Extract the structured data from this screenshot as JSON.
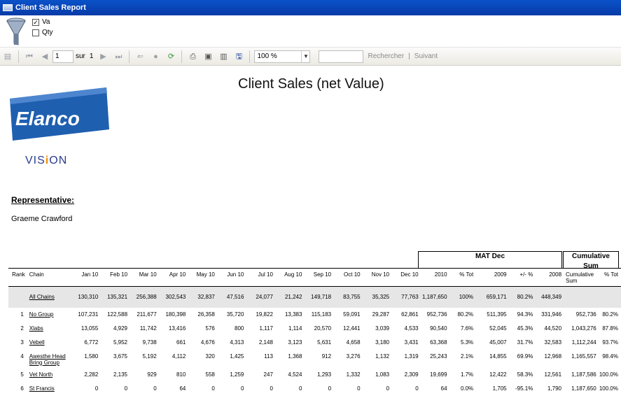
{
  "window": {
    "title": "Client Sales Report"
  },
  "params": {
    "checkboxes": [
      {
        "label": "Va",
        "checked": true
      },
      {
        "label": "Qty",
        "checked": false
      }
    ]
  },
  "toolbar": {
    "page_value": "1",
    "page_of": "sur",
    "page_total": "1",
    "zoom": "100 %",
    "find_value": "",
    "find_label": "Rechercher",
    "find_sep": "|",
    "next_label": "Suivant"
  },
  "report": {
    "title": "Client Sales (net Value)",
    "logo_text": "Elanco",
    "vision_pre": "VIS",
    "vision_i": "i",
    "vision_post": "ON",
    "rep_label": "Representative:",
    "rep_name": "Graeme Crawford",
    "group_mat": "MAT Dec",
    "group_cum": "Cumulative Sum",
    "columns": [
      "Rank",
      "Chain",
      "Jan 10",
      "Feb 10",
      "Mar 10",
      "Apr 10",
      "May 10",
      "Jun 10",
      "Jul 10",
      "Aug 10",
      "Sep 10",
      "Oct 10",
      "Nov 10",
      "Dec 10",
      "2010",
      "% Tot",
      "2009",
      "+/- %",
      "2008",
      "Cumulative Sum",
      "% Tot"
    ],
    "total_row": [
      "",
      "All Chains",
      "130,310",
      "135,321",
      "256,388",
      "302,543",
      "32,837",
      "47,516",
      "24,077",
      "21,242",
      "149,718",
      "83,755",
      "35,325",
      "77,763",
      "1,187,650",
      "100%",
      "659,171",
      "80.2%",
      "448,349",
      "",
      ""
    ],
    "rows": [
      [
        "1",
        "No Group",
        "107,231",
        "122,588",
        "211,677",
        "180,398",
        "26,358",
        "35,720",
        "19,822",
        "13,383",
        "115,183",
        "59,091",
        "29,287",
        "62,861",
        "952,736",
        "80.2%",
        "511,395",
        "94.3%",
        "331,946",
        "952,736",
        "80.2%"
      ],
      [
        "2",
        "Xlabs",
        "13,055",
        "4,929",
        "11,742",
        "13,416",
        "576",
        "800",
        "1,117",
        "1,114",
        "20,570",
        "12,441",
        "3,039",
        "4,533",
        "90,540",
        "7.6%",
        "52,045",
        "45.3%",
        "44,520",
        "1,043,276",
        "87.8%"
      ],
      [
        "3",
        "Vebell",
        "6,772",
        "5,952",
        "9,738",
        "661",
        "4,676",
        "4,313",
        "2,148",
        "3,123",
        "5,631",
        "4,658",
        "3,180",
        "3,431",
        "63,368",
        "5.3%",
        "45,007",
        "31.7%",
        "32,583",
        "1,112,244",
        "93.7%"
      ],
      [
        "4",
        "Awesthe Head Bring Group",
        "1,580",
        "3,675",
        "5,192",
        "4,112",
        "320",
        "1,425",
        "113",
        "1,368",
        "912",
        "3,276",
        "1,132",
        "1,319",
        "25,243",
        "2.1%",
        "14,855",
        "69.9%",
        "12,968",
        "1,165,557",
        "98.4%"
      ],
      [
        "5",
        "Vet North",
        "2,282",
        "2,135",
        "929",
        "810",
        "558",
        "1,259",
        "247",
        "4,524",
        "1,293",
        "1,332",
        "1,083",
        "2,309",
        "19,699",
        "1.7%",
        "12,422",
        "58.3%",
        "12,561",
        "1,187,586",
        "100.0%"
      ],
      [
        "6",
        "St Francis",
        "0",
        "0",
        "0",
        "64",
        "0",
        "0",
        "0",
        "0",
        "0",
        "0",
        "0",
        "0",
        "64",
        "0.0%",
        "1,705",
        "-95.1%",
        "1,790",
        "1,187,650",
        "100.0%"
      ]
    ]
  }
}
